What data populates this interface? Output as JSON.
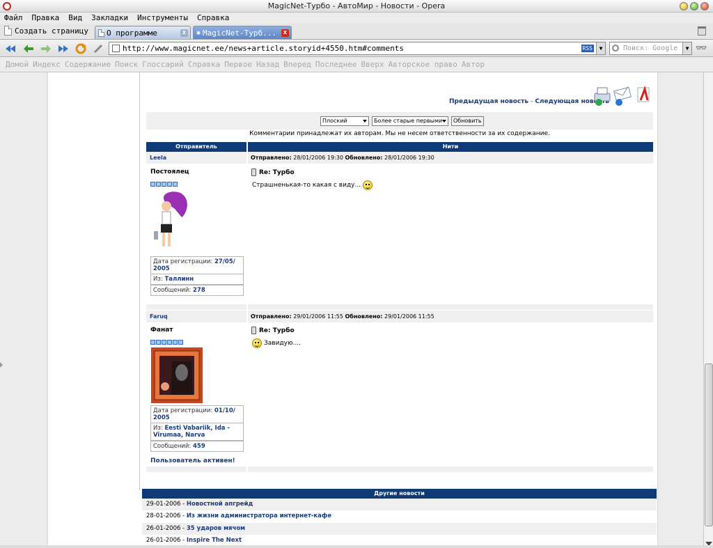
{
  "window": {
    "title": "MagicNet-Турбо - АвтоМир - Новости - Opera"
  },
  "menu": [
    "Файл",
    "Правка",
    "Вид",
    "Закладки",
    "Инструменты",
    "Справка"
  ],
  "tabs": {
    "new_page": "Создать страницу",
    "items": [
      {
        "label": "О программе",
        "active": false
      },
      {
        "label": "MagicNet-Турб...",
        "active": true
      }
    ]
  },
  "nav": {
    "url": "http://www.magicnet.ee/news+article.storyid+4550.htm#comments",
    "rss": "RSS",
    "search_placeholder": "Поиск: Google"
  },
  "linkbar": [
    "Домой",
    "Индекс",
    "Содержание",
    "Поиск",
    "Глоссарий",
    "Справка",
    "Первое",
    "Назад",
    "Вперед",
    "Последнее",
    "Вверх",
    "Авторское право",
    "Автор"
  ],
  "article_nav": {
    "prev": "Предыдущая новость",
    "sep": "-",
    "next": "Следующая новость"
  },
  "filter": {
    "mode": "Плоский",
    "order": "Более старые первыми",
    "refresh": "Обновить"
  },
  "disclaimer": "Комментарии принадлежат их авторам. Мы не несем ответственности за их содержание.",
  "table": {
    "col_sender": "Отправитель",
    "col_threads": "Нити"
  },
  "labels": {
    "sent": "Отправлено:",
    "updated": "Обновлено:",
    "reg": "Дата регистрации:",
    "from": "Из:",
    "messages": "Сообщений:"
  },
  "posts": [
    {
      "user": "Leela",
      "rank": "Постоялец",
      "sent": "28/01/2006 19:30",
      "updated": "28/01/2006 19:30",
      "reg_date_1": "27/05/",
      "reg_date_2": "2005",
      "from": "Таллинн",
      "messages": "278",
      "title": "Re: Турбо",
      "text": "Страшненькая-то какая с виду..."
    },
    {
      "user": "Faruq",
      "rank": "Фанат",
      "sent": "29/01/2006 11:55",
      "updated": "29/01/2006 11:55",
      "reg_date_1": "01/10/",
      "reg_date_2": "2005",
      "from_1": "Eesti Vabariik, Ida -",
      "from_2": "Virumaa, Narva",
      "messages": "459",
      "title": "Re: Турбо",
      "text": "Завидую....",
      "status": "Пользователь активен!"
    }
  ],
  "other_news": {
    "heading": "Другие новости",
    "sep": "-",
    "items": [
      {
        "date": "29-01-2006",
        "title": "Новостной апгрейд"
      },
      {
        "date": "28-01-2006",
        "title": "Из жизни администратора интернет-кафе"
      },
      {
        "date": "26-01-2006",
        "title": "35 ударов мячом"
      },
      {
        "date": "26-01-2006",
        "title": "Inspire The Next"
      }
    ]
  },
  "colors": {
    "header_blue": "#0f3a78",
    "link_blue": "#1a3b7a",
    "row_gray": "#efefef"
  }
}
